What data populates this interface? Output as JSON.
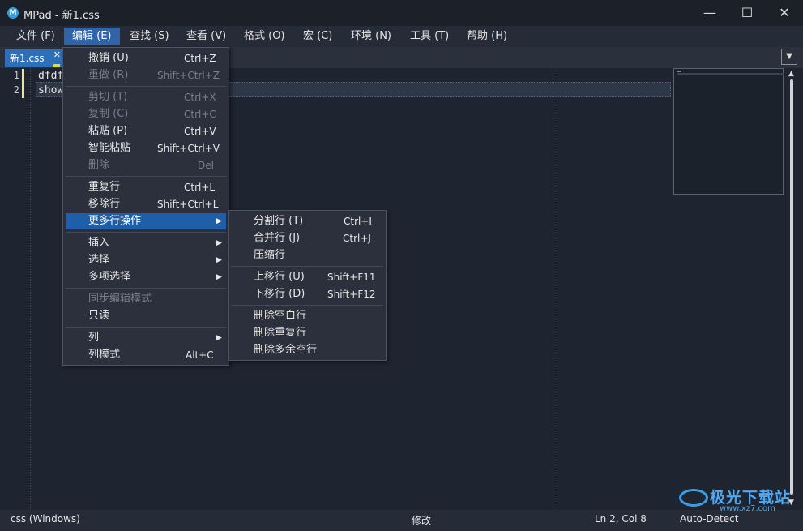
{
  "window": {
    "title": "MPad - 新1.css",
    "app_icon": "M",
    "controls": [
      "minimize-icon",
      "maximize-icon",
      "close-icon"
    ],
    "control_glyphs": [
      "—",
      "☐",
      "✕"
    ]
  },
  "menubar": [
    "文件 (F)",
    "编辑 (E)",
    "查找 (S)",
    "查看 (V)",
    "格式 (O)",
    "宏 (C)",
    "环境 (N)",
    "工具 (T)",
    "帮助 (H)"
  ],
  "tabs": [
    {
      "label": "新1.css",
      "close": "✕"
    }
  ],
  "tab_dropdown": "▼",
  "editor": {
    "line_numbers": [
      "1",
      "2"
    ],
    "lines": [
      "dfdf",
      "show"
    ]
  },
  "edit_menu": [
    {
      "label": "撤销 (U)",
      "shortcut": "Ctrl+Z",
      "disabled": false
    },
    {
      "label": "重做 (R)",
      "shortcut": "Shift+Ctrl+Z",
      "disabled": true
    },
    {
      "label": "剪切 (T)",
      "shortcut": "Ctrl+X",
      "disabled": true
    },
    {
      "label": "复制 (C)",
      "shortcut": "Ctrl+C",
      "disabled": true
    },
    {
      "label": "粘贴 (P)",
      "shortcut": "Ctrl+V",
      "disabled": false
    },
    {
      "label": "智能粘贴",
      "shortcut": "Shift+Ctrl+V",
      "disabled": false
    },
    {
      "label": "删除",
      "shortcut": "Del",
      "disabled": true
    },
    {
      "label": "重复行",
      "shortcut": "Ctrl+L",
      "disabled": false
    },
    {
      "label": "移除行",
      "shortcut": "Shift+Ctrl+L",
      "disabled": false
    },
    {
      "label": "更多行操作",
      "shortcut": "",
      "submenu": true,
      "selected": true
    },
    {
      "label": "插入",
      "shortcut": "",
      "submenu": true
    },
    {
      "label": "选择",
      "shortcut": "",
      "submenu": true
    },
    {
      "label": "多项选择",
      "shortcut": "",
      "submenu": true
    },
    {
      "label": "同步编辑模式",
      "shortcut": "",
      "disabled": true
    },
    {
      "label": "只读",
      "shortcut": "",
      "disabled": false
    },
    {
      "label": "列",
      "shortcut": "",
      "submenu": true
    },
    {
      "label": "列模式",
      "shortcut": "Alt+C",
      "disabled": false
    }
  ],
  "submenu_arrow": "▶",
  "line_ops_menu": [
    {
      "label": "分割行 (T)",
      "shortcut": "Ctrl+I"
    },
    {
      "label": "合并行 (J)",
      "shortcut": "Ctrl+J"
    },
    {
      "label": "压缩行",
      "shortcut": ""
    },
    {
      "label": "上移行 (U)",
      "shortcut": "Shift+F11"
    },
    {
      "label": "下移行 (D)",
      "shortcut": "Shift+F12"
    },
    {
      "label": "删除空白行",
      "shortcut": ""
    },
    {
      "label": "删除重复行",
      "shortcut": ""
    },
    {
      "label": "删除多余空行",
      "shortcut": ""
    }
  ],
  "status": {
    "syntax": "css (Windows)",
    "mode": "修改",
    "position": "Ln 2, Col 8",
    "encoding": "Auto-Detect"
  },
  "scroll_glyphs": {
    "up": "▲",
    "down": "▼"
  },
  "watermark": {
    "text": "极光下载站",
    "url": "www.xz7.com"
  },
  "colors": {
    "accent": "#3063a8",
    "menu_bg": "#2b303c",
    "editor_bg": "#1e2430",
    "selected": "#1f5ea8",
    "line_marker": "#f0e68c"
  }
}
